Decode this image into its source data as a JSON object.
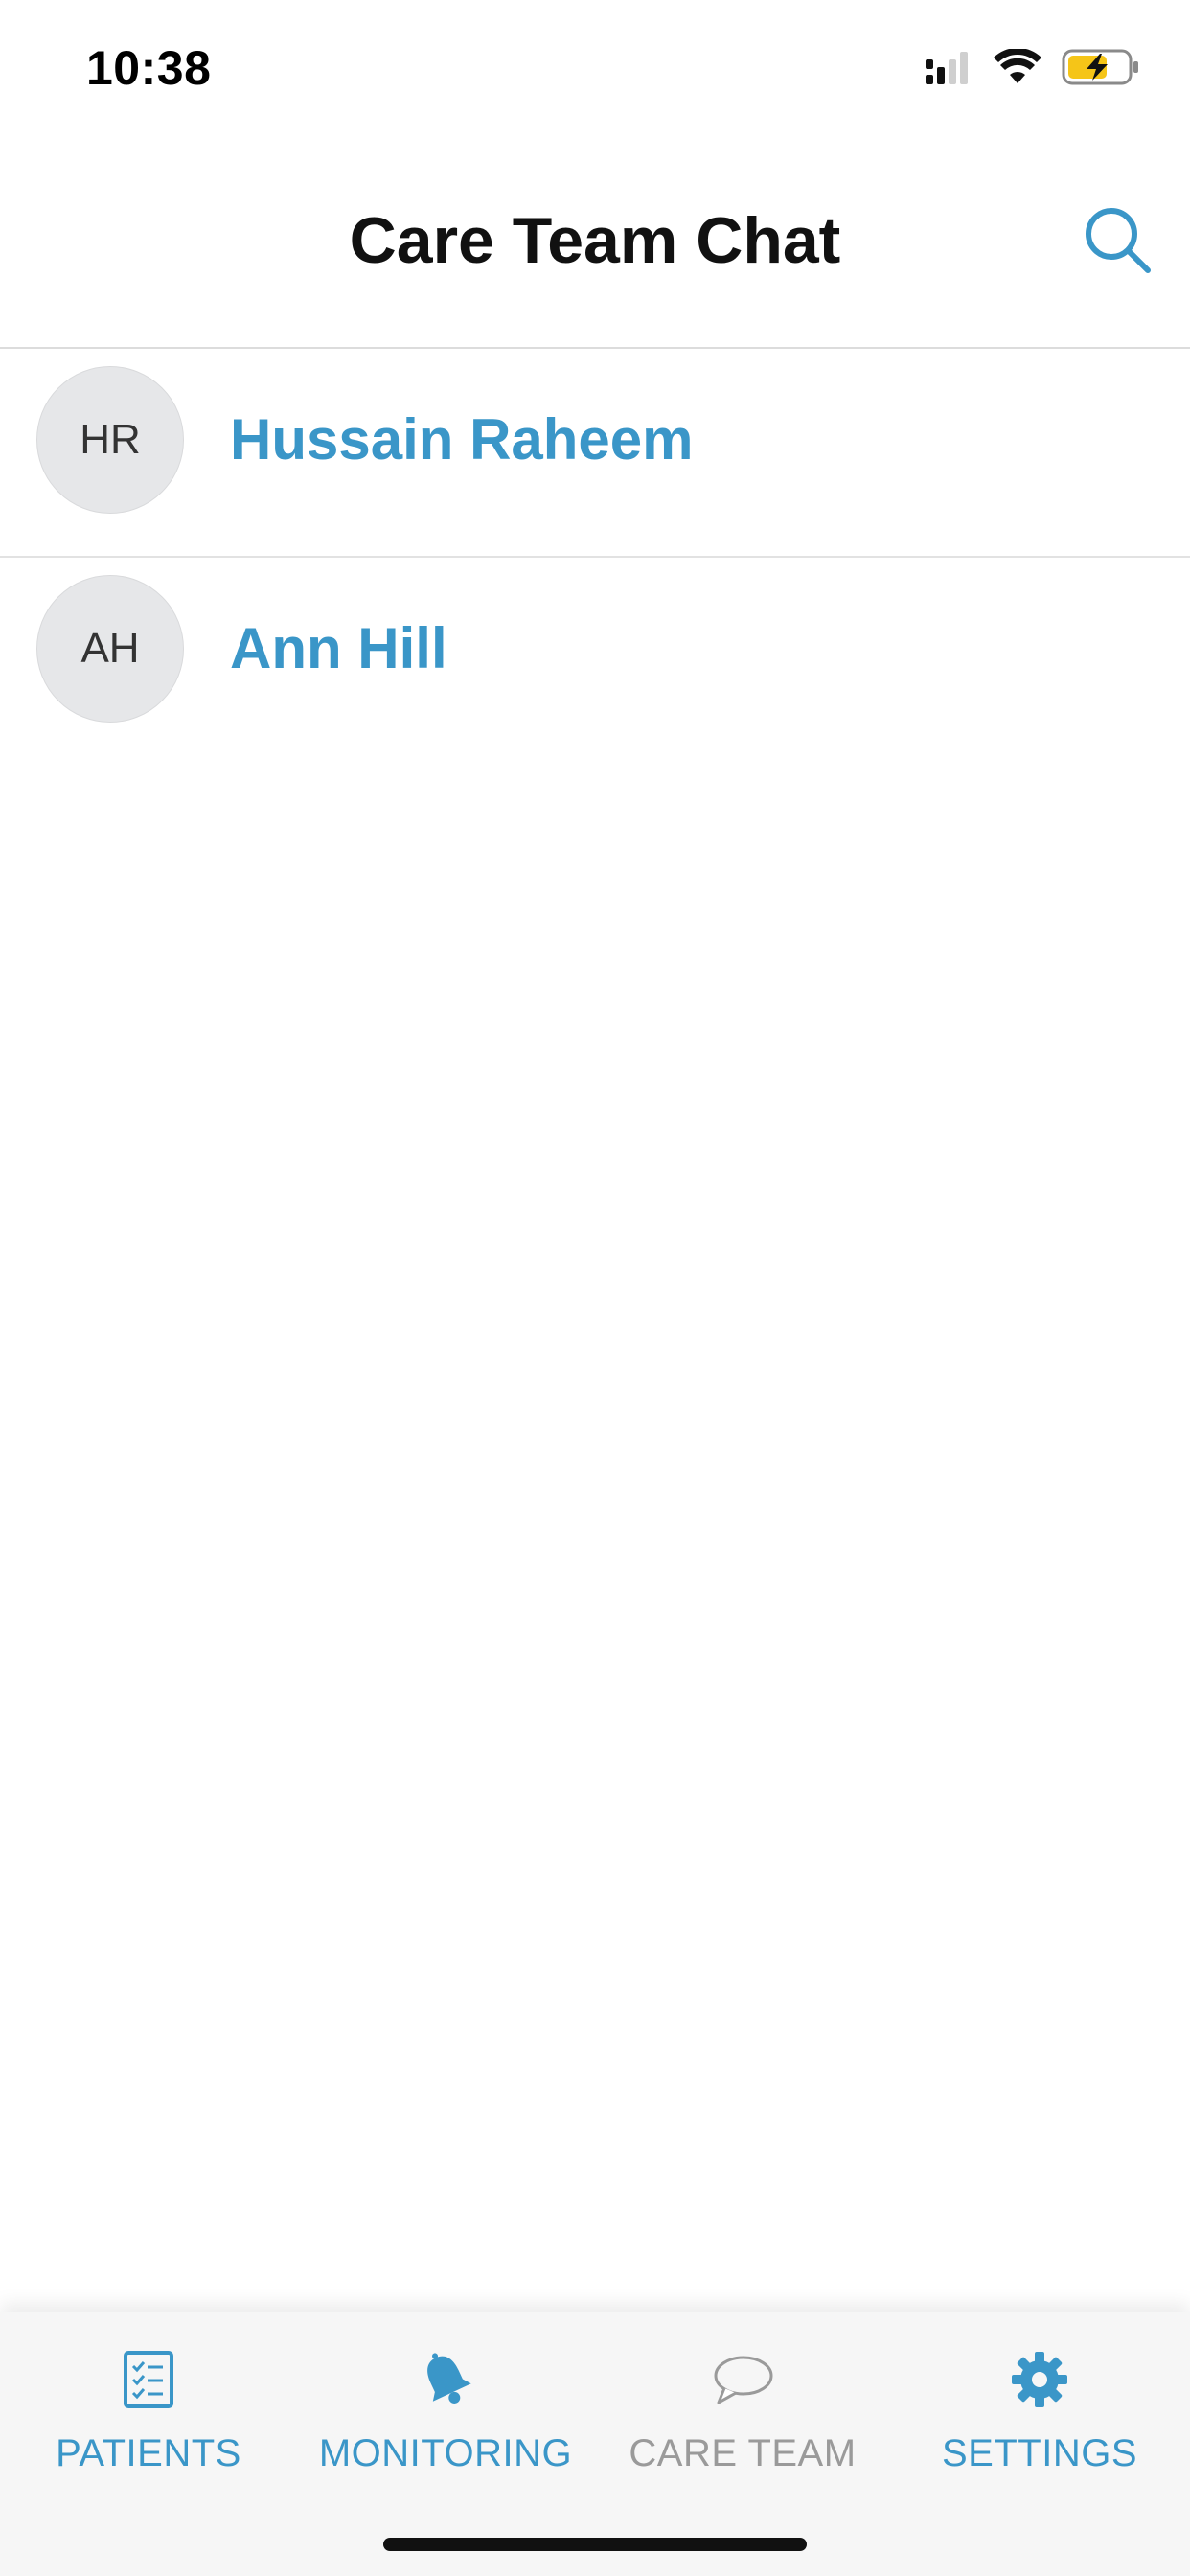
{
  "status_bar": {
    "time": "10:38",
    "icons": [
      "signal-icon",
      "wifi-icon",
      "battery-charging-icon"
    ]
  },
  "header": {
    "title": "Care Team Chat",
    "search_icon": "search-icon"
  },
  "chats": [
    {
      "initials": "HR",
      "name": "Hussain Raheem"
    },
    {
      "initials": "AH",
      "name": "Ann Hill"
    }
  ],
  "tabs": [
    {
      "label": "PATIENTS",
      "icon": "checklist-icon",
      "state": "active"
    },
    {
      "label": "MONITORING",
      "icon": "bell-icon",
      "state": "active"
    },
    {
      "label": "CARE TEAM",
      "icon": "chat-bubble-icon",
      "state": "selected"
    },
    {
      "label": "SETTINGS",
      "icon": "gear-icon",
      "state": "active"
    }
  ],
  "colors": {
    "accent": "#3a96c8",
    "inactive": "#9a9a9a",
    "avatar_bg": "#e6e7e9",
    "battery": "#f5c518"
  }
}
